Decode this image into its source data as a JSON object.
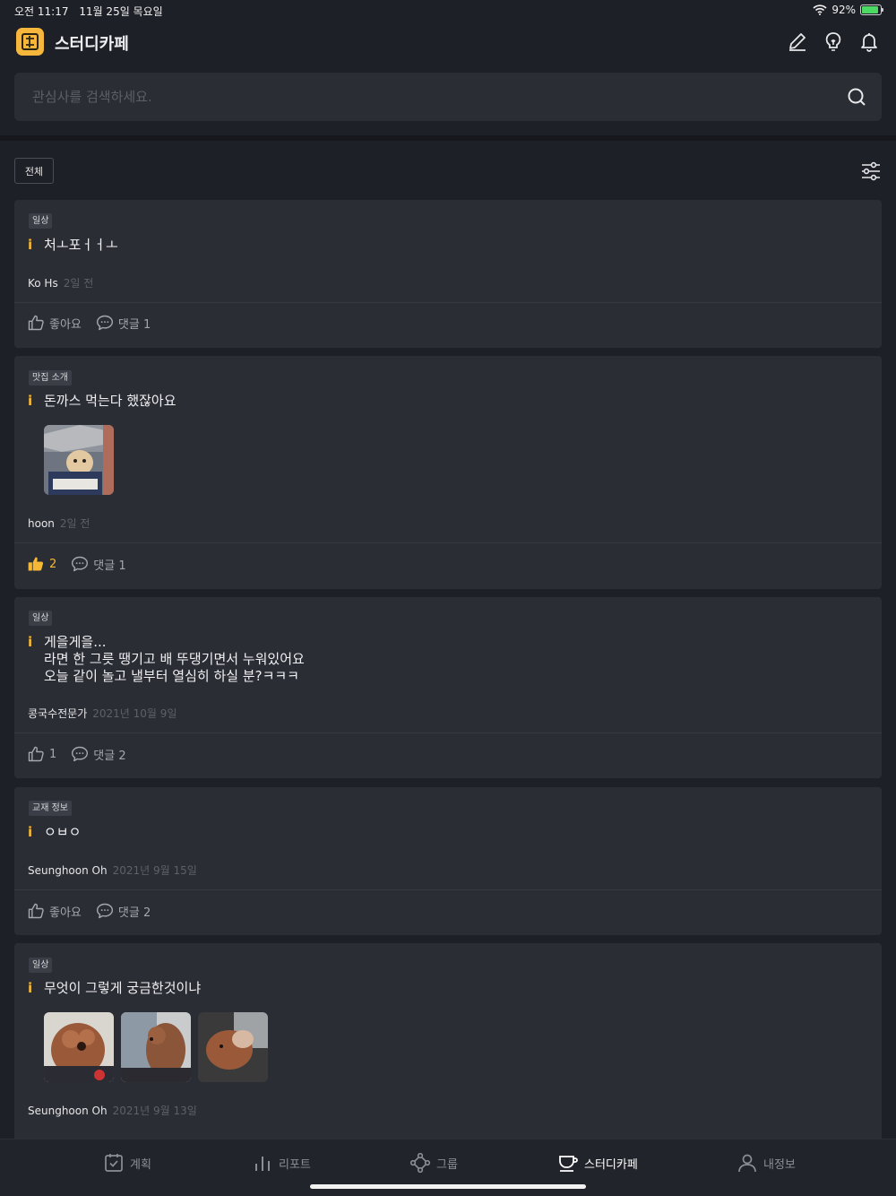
{
  "status_bar": {
    "time": "오전 11:17",
    "date": "11월 25일 목요일",
    "battery": "92%",
    "battery_level": 0.92
  },
  "header": {
    "title": "스터디카페",
    "icons": [
      "logo-icon",
      "edit-icon",
      "lightbulb-icon",
      "bell-icon"
    ]
  },
  "search": {
    "placeholder": "관심사를 검색하세요."
  },
  "filter": {
    "label": "전체"
  },
  "posts": [
    {
      "category": "일상",
      "title": "처ㅗ포ㅓㅓㅗ",
      "author": "Ko Hs",
      "date": "2일 전",
      "like_label": "좋아요",
      "liked": false,
      "comment_label": "댓글 1"
    },
    {
      "category": "맛집 소개",
      "title": "돈까스 먹는다 했잖아요",
      "author": "hoon",
      "date": "2일 전",
      "like_label": "2",
      "liked": true,
      "comment_label": "댓글 1"
    },
    {
      "category": "일상",
      "title": "게을게을...\n라면 한 그릇 땡기고 배 뚜댕기면서 누워있어요\n오늘 같이 놀고 낼부터 열심히 하실 분?ㅋㅋㅋ",
      "author": "콩국수전문가",
      "date": "2021년 10월 9일",
      "like_label": "1",
      "liked": false,
      "comment_label": "댓글 2"
    },
    {
      "category": "교재 정보",
      "title": "ㅇㅂㅇ",
      "author": "Seunghoon Oh",
      "date": "2021년 9월 15일",
      "like_label": "좋아요",
      "liked": false,
      "comment_label": "댓글 2"
    },
    {
      "category": "일상",
      "title": "무엇이 그렇게 궁금한것이냐",
      "author": "Seunghoon Oh",
      "date": "2021년 9월 13일"
    }
  ],
  "info_mark": "i",
  "bottom_nav": [
    {
      "label": "계획",
      "icon": "calendar-check-icon"
    },
    {
      "label": "리포트",
      "icon": "bar-chart-icon"
    },
    {
      "label": "그룹",
      "icon": "group-icon"
    },
    {
      "label": "스터디카페",
      "icon": "coffee-cup-icon",
      "active": true
    },
    {
      "label": "내정보",
      "icon": "person-icon"
    }
  ],
  "colors": {
    "accent": "#f5b835",
    "background": "#1e2027",
    "card": "#2b2d35"
  }
}
